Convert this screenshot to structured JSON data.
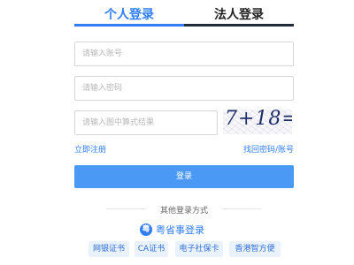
{
  "tabs": [
    {
      "label": "个人登录",
      "active": true
    },
    {
      "label": "法人登录",
      "active": false
    }
  ],
  "form": {
    "account_placeholder": "请输入账号",
    "password_placeholder": "请输入密码",
    "captcha_placeholder": "请输入图中算式结果",
    "captcha_text": "7+18=?"
  },
  "links": {
    "register": "立即注册",
    "recover": "找回密码/账号"
  },
  "login_button": "登录",
  "other_methods": {
    "title": "其他登录方式",
    "yss_label": "粤省事登录",
    "yss_icon": "yss-logo-icon",
    "options": [
      "网银证书",
      "CA证书",
      "电子社保卡",
      "香港智方便"
    ]
  },
  "colors": {
    "accent": "#2f7ef6",
    "button": "#4a99f5",
    "chip_bg": "#eaf2fd"
  }
}
